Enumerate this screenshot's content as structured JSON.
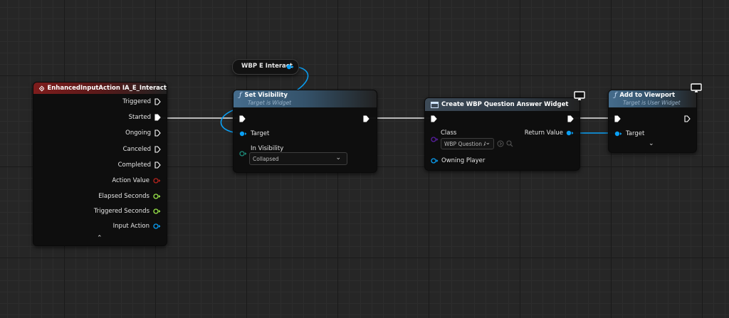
{
  "colors": {
    "exec": "#ffffff",
    "object_pin": "#0aa0f5",
    "class_pin": "#5a1fa3",
    "float_pin": "#9be84a",
    "bool_pin": "#b7241e",
    "visibility_pin": "#1d8a78",
    "event_header": "#7e1c1c",
    "function_header": "#456c8c"
  },
  "event_node": {
    "title": "EnhancedInputAction IA_E_Interact",
    "icon": "diamond-event-icon",
    "pins": [
      {
        "label": "Triggered",
        "type": "exec"
      },
      {
        "label": "Started",
        "type": "exec",
        "connected": true
      },
      {
        "label": "Ongoing",
        "type": "exec"
      },
      {
        "label": "Canceled",
        "type": "exec"
      },
      {
        "label": "Completed",
        "type": "exec"
      },
      {
        "label": "Action Value",
        "type": "bool"
      },
      {
        "label": "Elapsed Seconds",
        "type": "float"
      },
      {
        "label": "Triggered Seconds",
        "type": "float"
      },
      {
        "label": "Input Action",
        "type": "object"
      }
    ],
    "collapse_icon": "chevron-up-icon"
  },
  "variable_node": {
    "label": "WBP E Interact"
  },
  "set_visibility_node": {
    "title": "Set Visibility",
    "subtitle": "Target is Widget",
    "target_label": "Target",
    "in_visibility_label": "In Visibility",
    "in_visibility_value": "Collapsed"
  },
  "create_widget_node": {
    "title": "Create WBP Question Answer Widget",
    "class_label": "Class",
    "class_value": "WBP Question A",
    "return_label": "Return Value",
    "owning_player_label": "Owning Player"
  },
  "add_viewport_node": {
    "title": "Add to Viewport",
    "subtitle": "Target is User Widget",
    "target_label": "Target",
    "expand_icon": "chevron-down-icon"
  }
}
